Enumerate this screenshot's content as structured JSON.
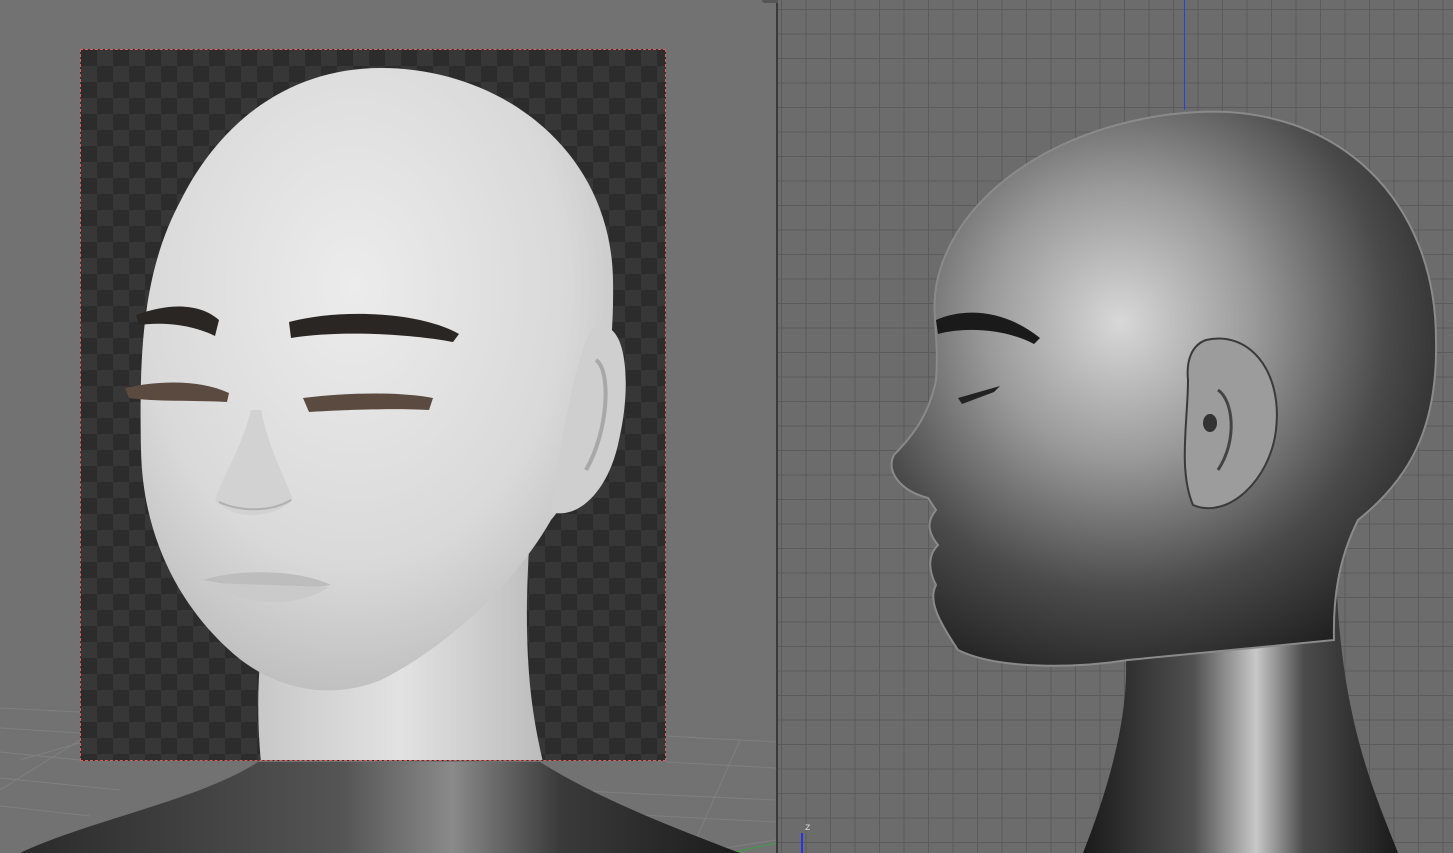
{
  "viewports": {
    "left": {
      "kind": "perspective",
      "render_region": "active"
    },
    "right": {
      "kind": "orthographic-side"
    }
  },
  "axis_gizmo": {
    "z_label": "z"
  },
  "colors": {
    "viewport_bg": "#727272",
    "grid_line": "#5b5b5b",
    "render_border": "#d86060",
    "z_axis": "#2a34e6"
  },
  "icons": [
    "axis-gizmo-icon"
  ]
}
